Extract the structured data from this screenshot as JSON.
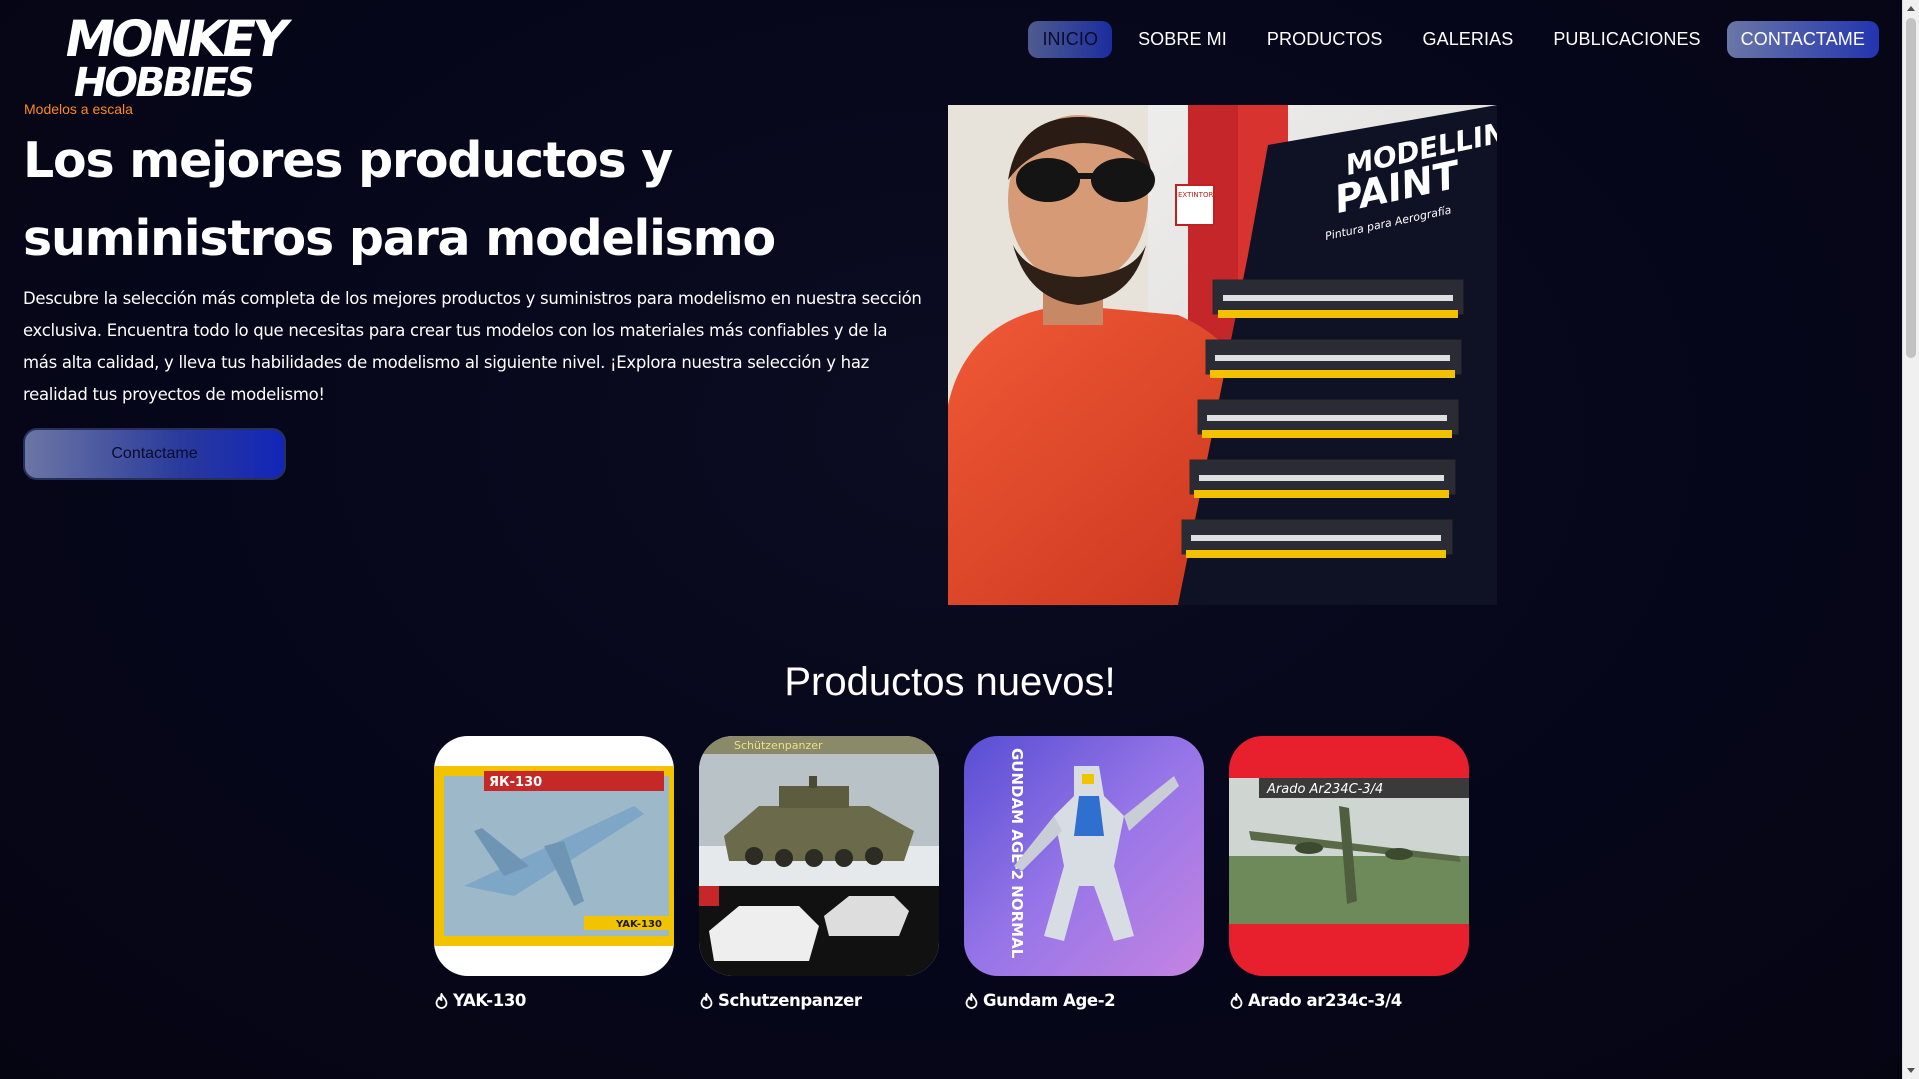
{
  "header": {
    "logo_line1": "MONKEY",
    "logo_line2": "HOBBIES",
    "tagline": "Modelos a escala"
  },
  "nav": {
    "items": [
      {
        "label": "INICIO",
        "active": true
      },
      {
        "label": "SOBRE MI"
      },
      {
        "label": "PRODUCTOS"
      },
      {
        "label": "GALERIAS"
      },
      {
        "label": "PUBLICACIONES"
      },
      {
        "label": "CONTACTAME",
        "highlight": true
      }
    ]
  },
  "hero": {
    "title_line1": "Los mejores productos y",
    "title_line2": "suministros para modelismo",
    "description": "Descubre la selección más completa de los mejores productos y suministros para modelismo en nuestra sección exclusiva. Encuentra todo lo que necesitas para crear tus modelos con los materiales más confiables y de la más alta calidad, y lleva tus habilidades de modelismo al siguiente nivel. ¡Explora nuestra selección y haz realidad tus proyectos de modelismo!",
    "button_label": "Contactame",
    "photo_sign_line1": "MODELLING",
    "photo_sign_line2": "PAINT",
    "photo_sign_sub": "Pintura para Aerografía",
    "photo_extintor": "EXTINTOR"
  },
  "products": {
    "title": "Productos nuevos!",
    "items": [
      {
        "name": "YAK-130",
        "box_title": "ЯК-130",
        "box_subtitle": "YAK-130"
      },
      {
        "name": "Schutzenpanzer",
        "box_title": "Schützenpanzer"
      },
      {
        "name": "Gundam Age-2",
        "box_title": "GUNDAM AGE-2 NORMAL"
      },
      {
        "name": "Arado ar234c-3/4",
        "box_title": "Arado Ar234C-3/4"
      }
    ]
  },
  "colors": {
    "background": "#08081a",
    "accent_orange": "#ff8a1e",
    "gradient_start": "#6a76a6",
    "gradient_end": "#1225b8"
  },
  "icons": {
    "product_label_icon": "fire-icon"
  }
}
